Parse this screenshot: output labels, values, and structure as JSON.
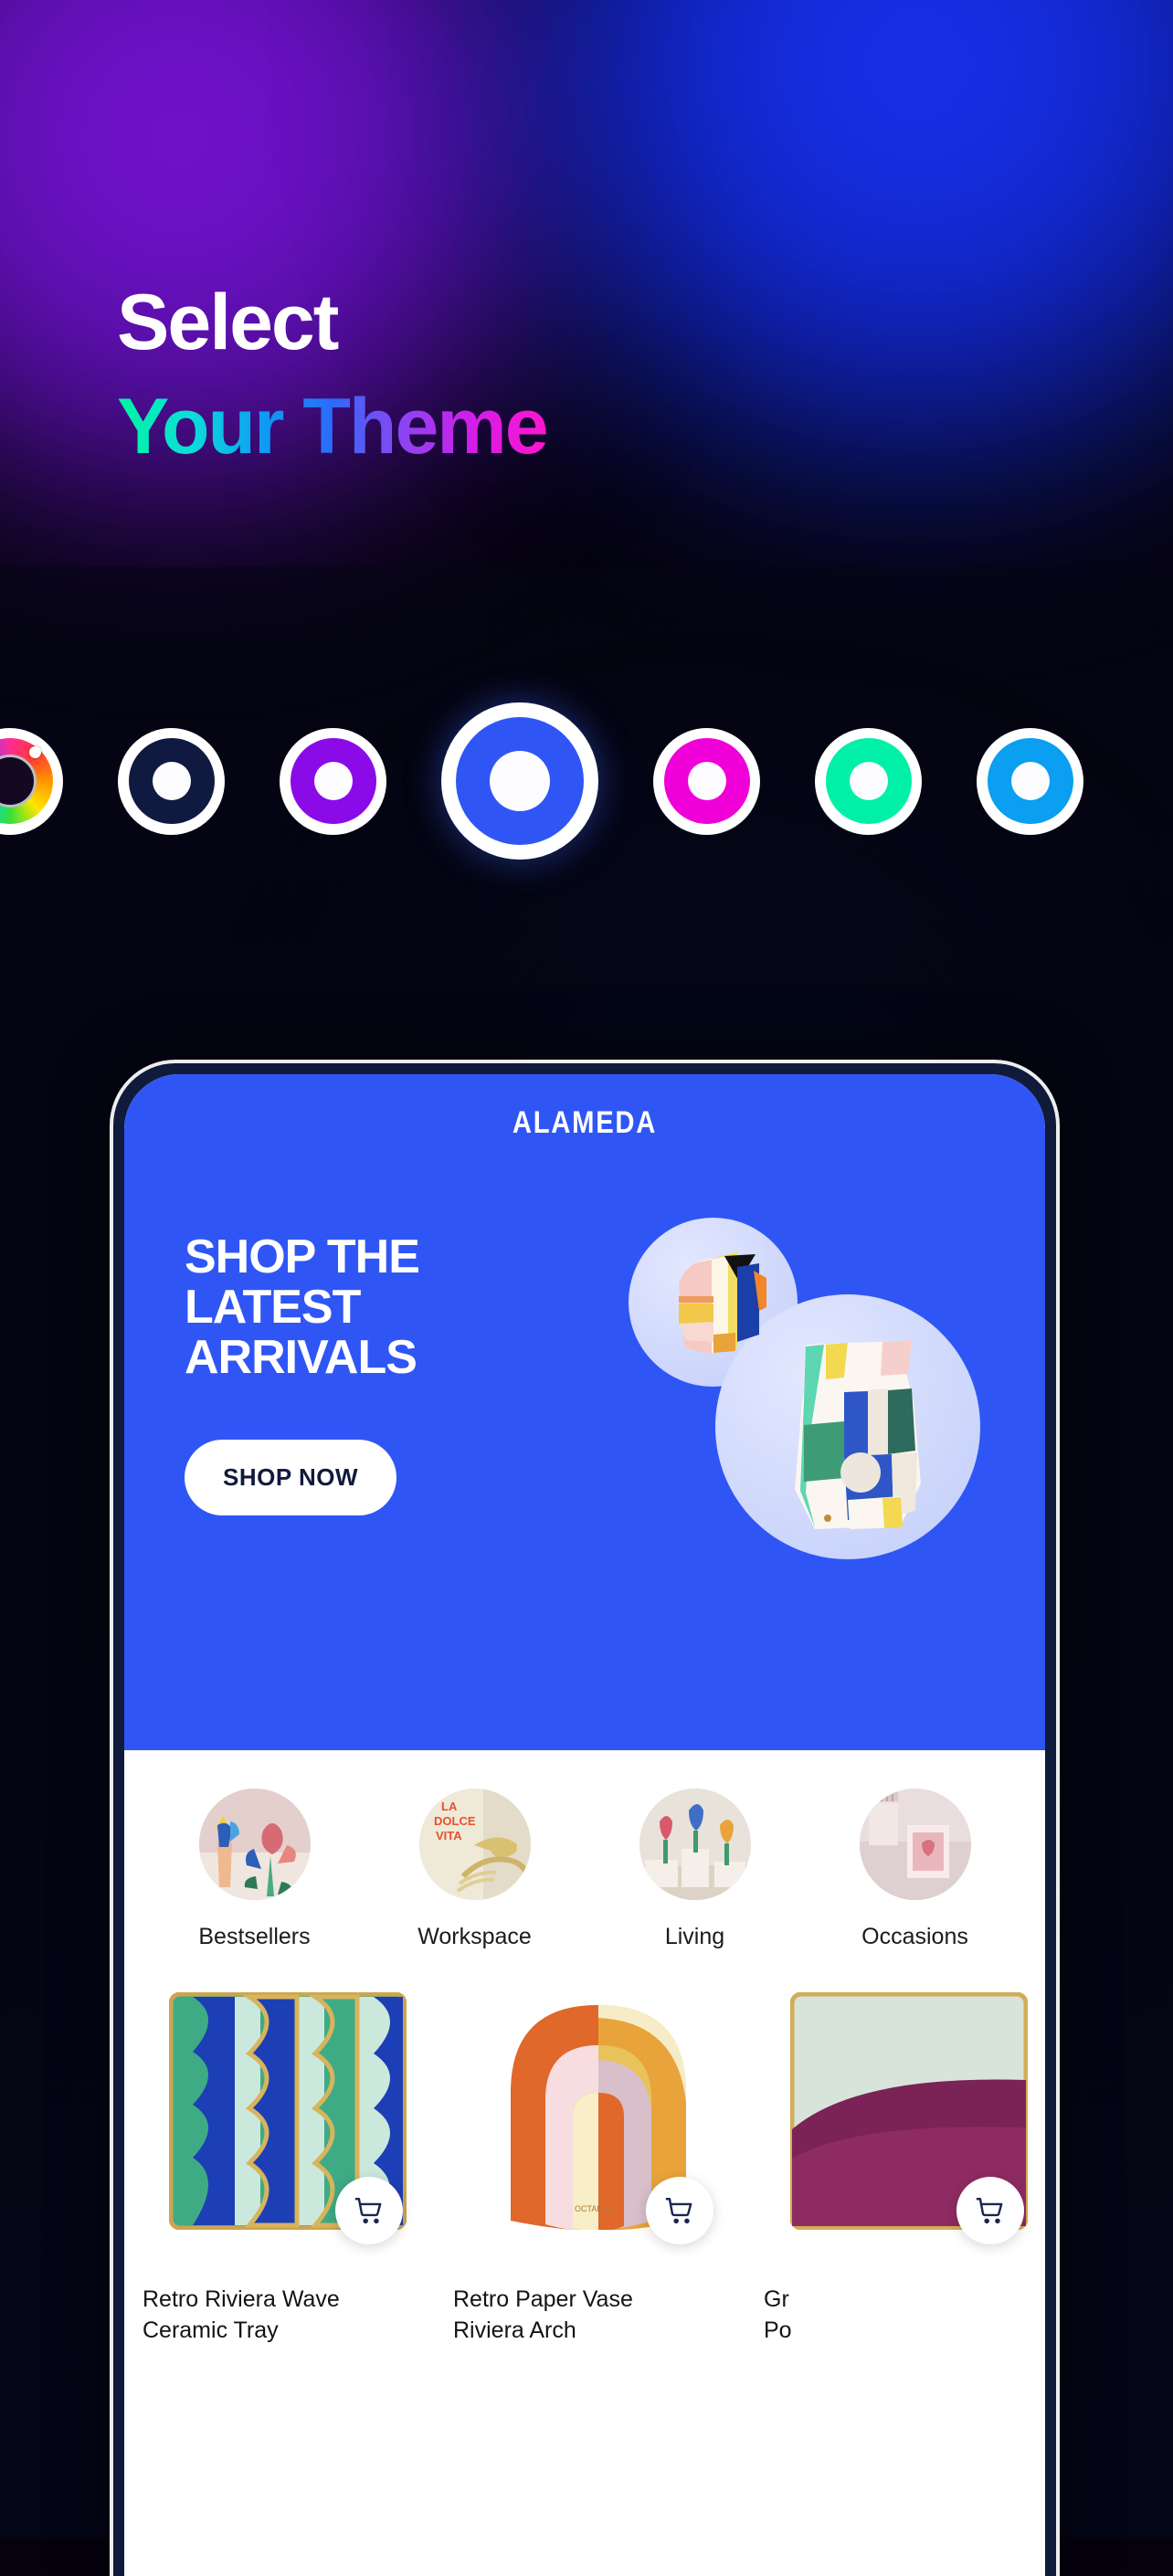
{
  "headline": {
    "line1": "Select",
    "line2": "Your Theme",
    "line2_gradient": [
      "#00F5A0",
      "#0ADFD8",
      "#0E9BF5",
      "#2C6BFA",
      "#8A45F2",
      "#D31DE8",
      "#FF16CE"
    ]
  },
  "theme_picker": {
    "selected_index": 3,
    "swatches": [
      {
        "name": "custom-color-wheel",
        "color": "rainbow",
        "selected": false
      },
      {
        "name": "midnight-navy",
        "color": "#101A40",
        "selected": false
      },
      {
        "name": "violet",
        "color": "#8A0BE8",
        "selected": false
      },
      {
        "name": "royal-blue",
        "color": "#2F56F5",
        "selected": true
      },
      {
        "name": "magenta",
        "color": "#F000D8",
        "selected": false
      },
      {
        "name": "spring-green",
        "color": "#00F0A8",
        "selected": false
      },
      {
        "name": "sky-blue",
        "color": "#0A9FF0",
        "selected": false
      }
    ]
  },
  "phone": {
    "accent_color": "#2F56F5",
    "brand": "ALAMEDA",
    "hero": {
      "title_lines": [
        "SHOP THE",
        "LATEST",
        "ARRIVALS"
      ],
      "cta_label": "SHOP NOW"
    },
    "categories": [
      {
        "label": "Bestsellers"
      },
      {
        "label": "Workspace"
      },
      {
        "label": "Living"
      },
      {
        "label": "Occasions"
      }
    ],
    "products": [
      {
        "title": "Retro Riviera Wave\nCeramic Tray",
        "cart_icon": "cart-icon"
      },
      {
        "title": "Retro Paper Vase\nRiviera Arch",
        "cart_icon": "cart-icon"
      },
      {
        "title": "Gr\nPo",
        "cart_icon": "cart-icon"
      }
    ]
  }
}
